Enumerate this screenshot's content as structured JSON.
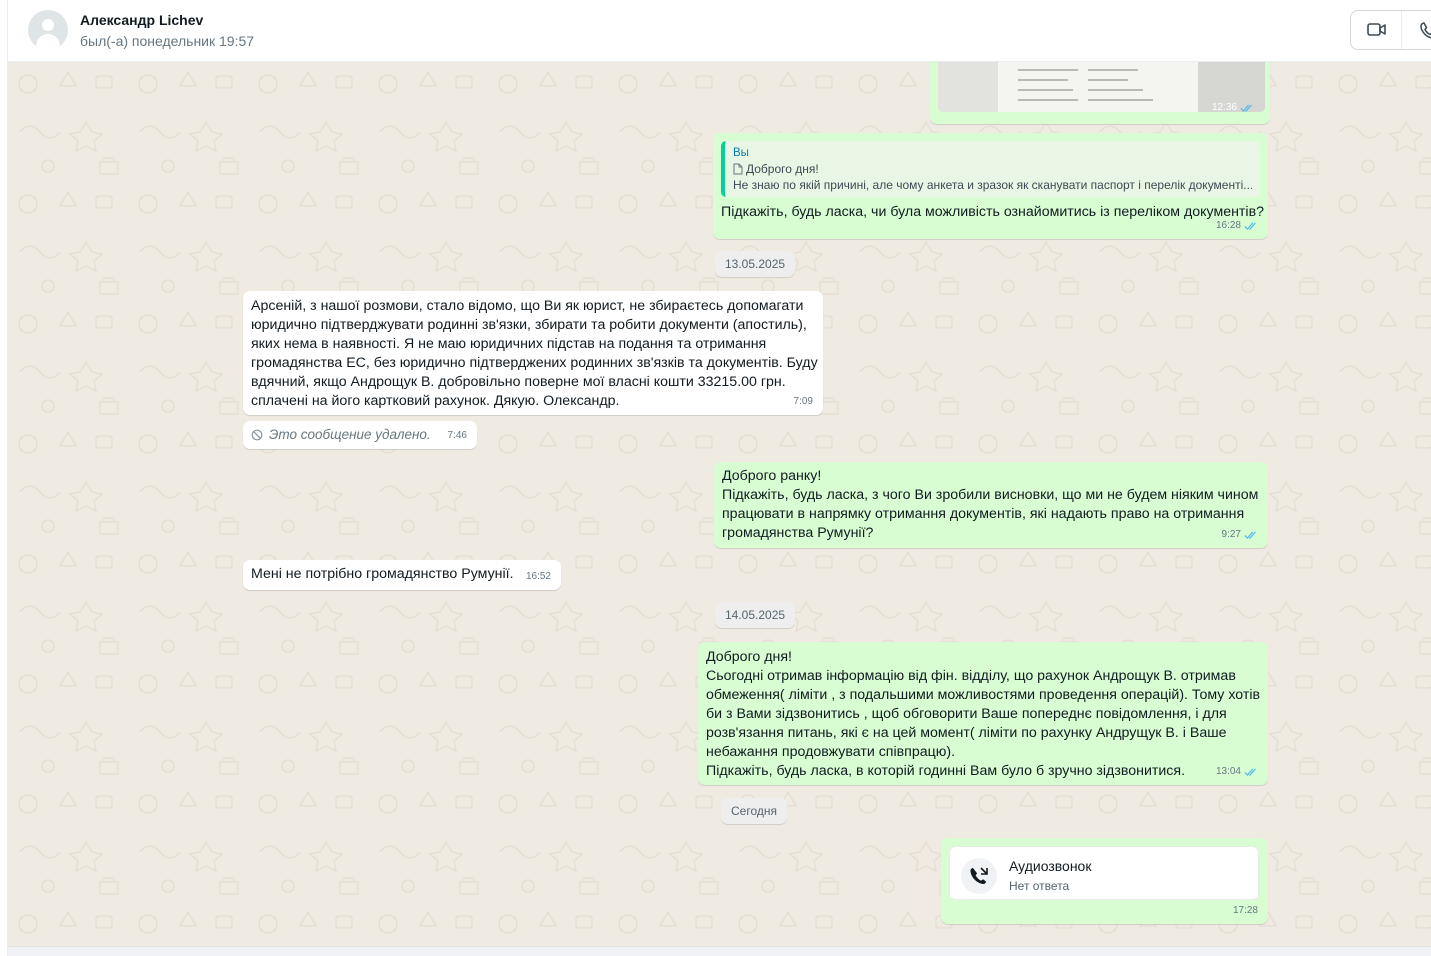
{
  "header": {
    "contact_name": "Александр Lichev",
    "status": "был(-а) понедельник 19:57",
    "video_icon": "video-camera-icon",
    "phone_icon": "phone-icon"
  },
  "colors": {
    "outgoing_bubble": "#d9fdd3",
    "incoming_bubble": "#ffffff",
    "chat_background": "#efeae2",
    "read_ticks": "#53bdeb"
  },
  "messages": {
    "image_msg": {
      "time": "12:36"
    },
    "m1": {
      "quote_author": "Вы",
      "quote_line1": "Доброго дня!",
      "quote_line2": "Не знаю по якій причині, але чому анкета и зразок як сканувати паспорт і перелік документі...",
      "text": "Підкажіть, будь ласка, чи була можливість ознайомитись із переліком документів?",
      "time": "16:28"
    },
    "date1": "13.05.2025",
    "m2": {
      "text": "Арсеній, з нашої розмови, стало відомо, що Ви як юрист, не збираєтесь допомагати\nюридично підтверджувати родинні зв'язки, збирати та робити документи (апостиль),\nяких нема в наявності. Я не маю юридичних підстав на подання та отримання\nгромадянства ЕС, без юридично підтверджених родинних зв'язків та документів. Буду\nвдячний, якщо Андрощук В. добровільно поверне мої власні кошти 33215.00 грн.\nсплачені на його картковий рахунок. Дякую. Олександр.",
      "time": "7:09"
    },
    "m3": {
      "text": "Это сообщение удалено.",
      "time": "7:46"
    },
    "m4": {
      "text": "Доброго ранку!\nПідкажіть, будь ласка, з чого Ви зробили висновки, що ми не будем ніяким чином\nпрацювати в напрямку отримання документів, які надають право на отримання\nгромадянства Румунії?",
      "time": "9:27"
    },
    "m5": {
      "text": "Мені не потрібно громадянство Румунії.",
      "time": "16:52"
    },
    "date2": "14.05.2025",
    "m6": {
      "text": "Доброго дня!\nСьогодні отримав інформацію від фін. відділу, що рахунок Андрощук В. отримав\nобмеження( ліміти , з подальшими можливостями проведення операцій). Тому хотів\nби з Вами зідзвонитись , щоб обговорити Ваше попереднє повідомлення, і для\nрозв'язання питань, які є на цей момент( ліміти по рахунку Андрущук В. і Ваше\nнебажання продовжувати співпрацю).\nПідкажіть, будь ласка, в которій годинні Вам було б зручно зідзвонитися.",
      "time": "13:04"
    },
    "date3": "Сегодня",
    "m7": {
      "title": "Аудиозвонок",
      "subtitle": "Нет ответа",
      "time": "17:28"
    }
  }
}
